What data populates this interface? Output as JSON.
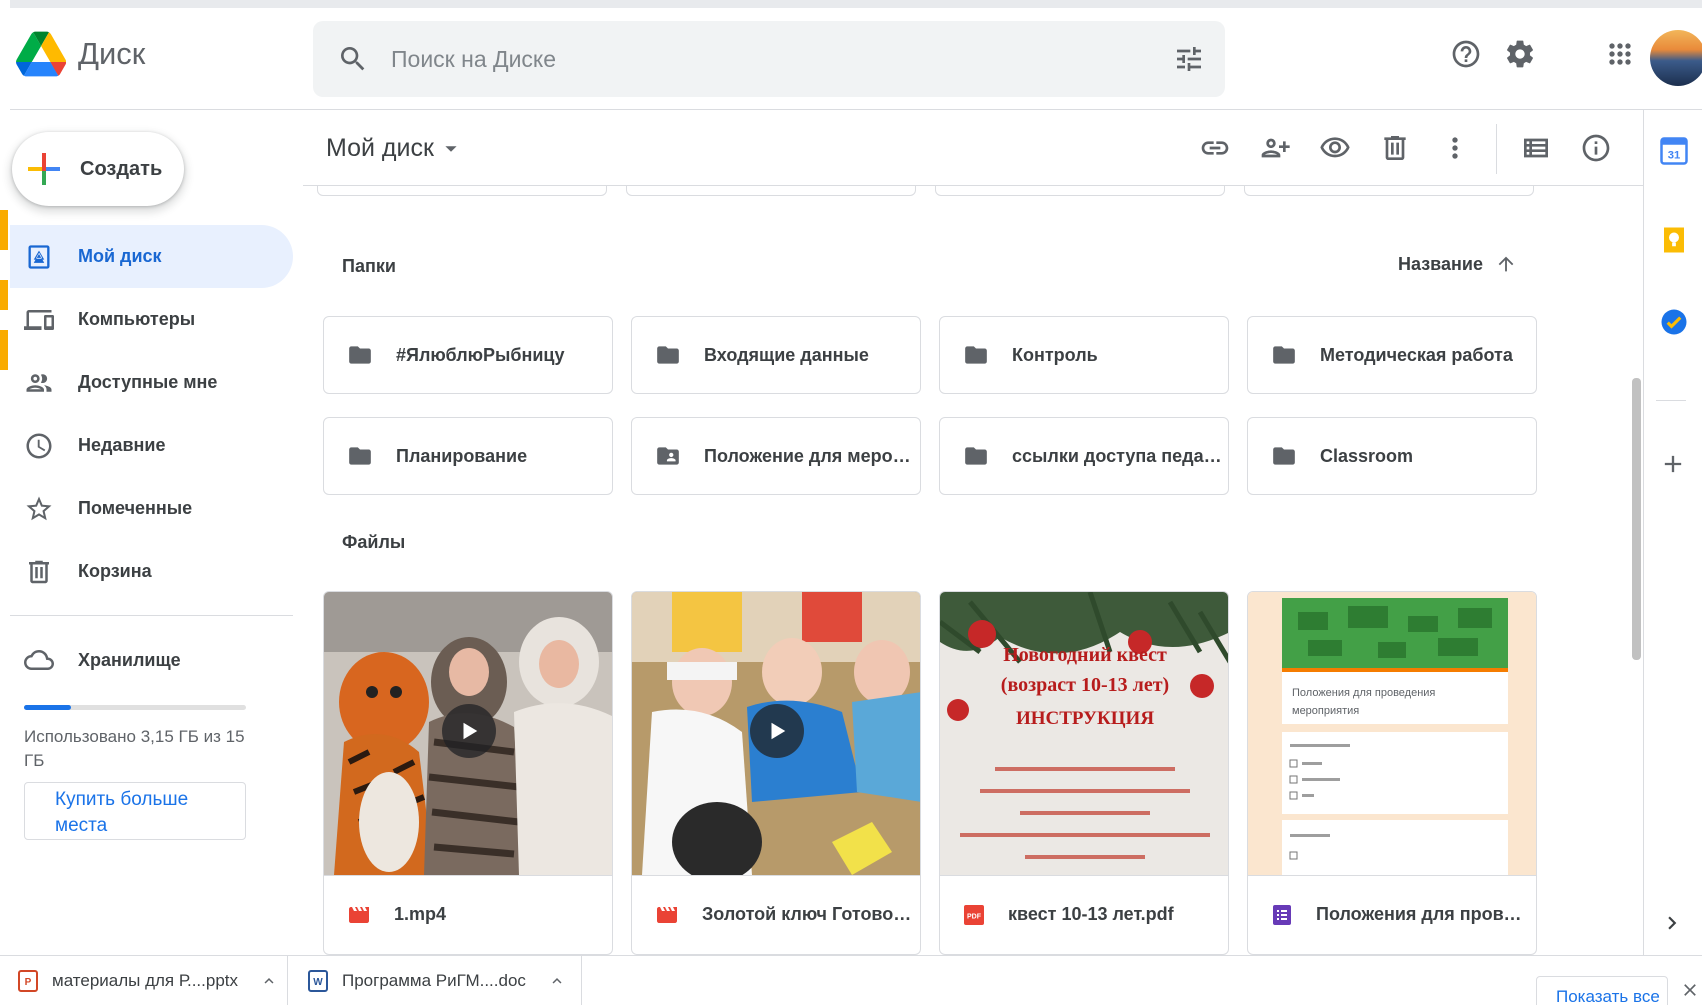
{
  "app": {
    "name": "Диск"
  },
  "search": {
    "placeholder": "Поиск на Диске"
  },
  "sidebar": {
    "create_label": "Создать",
    "items": [
      {
        "label": "Мой диск",
        "icon": "my-drive-icon",
        "active": true
      },
      {
        "label": "Компьютеры",
        "icon": "computers-icon",
        "active": false
      },
      {
        "label": "Доступные мне",
        "icon": "shared-icon",
        "active": false
      },
      {
        "label": "Недавние",
        "icon": "clock-icon",
        "active": false
      },
      {
        "label": "Помеченные",
        "icon": "star-icon",
        "active": false
      },
      {
        "label": "Корзина",
        "icon": "trash-icon",
        "active": false
      }
    ],
    "storage_label": "Хранилище",
    "storage_used_text": "Использовано 3,15 ГБ из 15 ГБ",
    "storage_used_fraction": 0.21,
    "buy_more_label": "Купить больше места"
  },
  "toolbar": {
    "breadcrumb": "Мой диск"
  },
  "content": {
    "folders_title": "Папки",
    "sort_label": "Название",
    "folders": [
      {
        "name": "#ЯлюблюРыбницу",
        "shared": false
      },
      {
        "name": "Входящие данные",
        "shared": false
      },
      {
        "name": "Контроль",
        "shared": false
      },
      {
        "name": "Методическая работа",
        "shared": false
      },
      {
        "name": "Планирование",
        "shared": false
      },
      {
        "name": "Положение для меропр...",
        "shared": true
      },
      {
        "name": "ссылки доступа педагог...",
        "shared": false
      },
      {
        "name": "Classroom",
        "shared": false
      }
    ],
    "files_title": "Файлы",
    "files": [
      {
        "name": "1.mp4",
        "type": "video"
      },
      {
        "name": "Золотой ключ Готовое....",
        "type": "video"
      },
      {
        "name": "квест 10-13 лет.pdf",
        "type": "pdf",
        "thumb_title": "Новогодний квест",
        "thumb_subtitle": "(возраст 10-13 лет)",
        "thumb_heading": "ИНСТРУКЦИЯ"
      },
      {
        "name": "Положения для провед...",
        "type": "form",
        "thumb_title": "Положения для проведения мероприятия"
      }
    ]
  },
  "downloads": {
    "items": [
      {
        "name": "материалы для Р....pptx"
      },
      {
        "name": "Программа РиГМ....doc"
      }
    ],
    "show_all_label": "Показать все"
  },
  "colors": {
    "accent": "#1a73e8",
    "active_bg": "#e8f0fe",
    "video_red": "#ea4335",
    "pdf_red": "#ea4335",
    "form_purple": "#673ab7"
  }
}
